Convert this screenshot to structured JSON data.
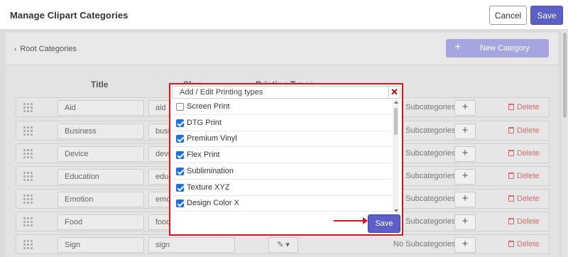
{
  "header": {
    "title": "Manage Clipart Categories",
    "cancel_label": "Cancel",
    "save_label": "Save"
  },
  "toolbar": {
    "breadcrumb": "Root Categories",
    "new_category_label": "New Category",
    "plus_glyph": "+"
  },
  "columns": {
    "title": "Title",
    "slug": "Slug",
    "printing_types": "Printing Types"
  },
  "rows": [
    {
      "title": "Aid",
      "slug": "aid",
      "subcategories": "No Subcategories",
      "delete": "Delete"
    },
    {
      "title": "Business",
      "slug": "business",
      "subcategories": "No Subcategories",
      "delete": "Delete"
    },
    {
      "title": "Device",
      "slug": "device",
      "subcategories": "No Subcategories",
      "delete": "Delete"
    },
    {
      "title": "Education",
      "slug": "education",
      "subcategories": "No Subcategories",
      "delete": "Delete"
    },
    {
      "title": "Emotion",
      "slug": "emotion",
      "subcategories": "No Subcategories",
      "delete": "Delete"
    },
    {
      "title": "Food",
      "slug": "food",
      "subcategories": "No Subcategories",
      "delete": "Delete"
    },
    {
      "title": "Sign",
      "slug": "sign",
      "subcategories": "No Subcategories",
      "delete": "Delete"
    }
  ],
  "modal": {
    "title": "Add / Edit Printing types",
    "close_glyph": "✕",
    "save_label": "Save",
    "options": [
      {
        "label": "Screen Print",
        "checked": false
      },
      {
        "label": "DTG Print",
        "checked": true
      },
      {
        "label": "Premium Vinyl",
        "checked": true
      },
      {
        "label": "Flex Print",
        "checked": true
      },
      {
        "label": "Sublimination",
        "checked": true
      },
      {
        "label": "Texture XYZ",
        "checked": true
      },
      {
        "label": "Design Color X",
        "checked": true
      }
    ]
  },
  "colors": {
    "accent": "#5b5fc7",
    "highlight": "#e0131c",
    "checkbox": "#1e6fd9",
    "delete": "#d86a6a"
  }
}
